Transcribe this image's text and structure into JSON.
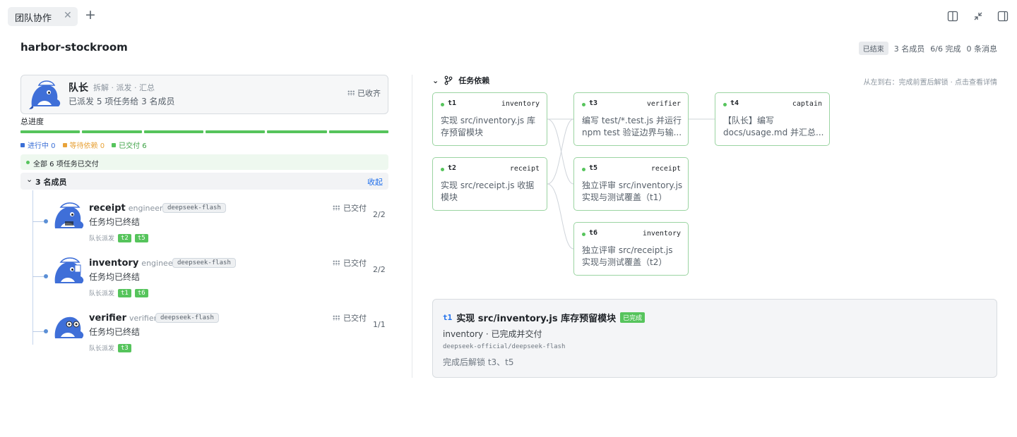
{
  "tab": {
    "label": "团队协作",
    "close": "✕",
    "add": "+"
  },
  "header": {
    "title": "harbor-stockroom",
    "status_badge": "已结束",
    "members": "3 名成员",
    "progress": "6/6 完成",
    "messages": "0 条消息"
  },
  "captain": {
    "name": "队长",
    "role": "拆解 · 派发 · 汇总",
    "description": "已派发 5 项任务给 3 名成员",
    "status": "已收齐"
  },
  "progress": {
    "label": "总进度",
    "segments_total": 6,
    "segments_done": 6,
    "legend": [
      {
        "label": "进行中 0",
        "color": "#3b6fd6"
      },
      {
        "label": "等待依赖 0",
        "color": "#e8a33a"
      },
      {
        "label": "已交付 6",
        "color": "#56c45c"
      }
    ]
  },
  "all_done": "全部 6 项任务已交付",
  "members_section": {
    "title": "3 名成员",
    "caret": "⌄",
    "collapse": "收起",
    "assign_label": "队长派发",
    "items": [
      {
        "name": "receipt",
        "role": "engineer",
        "model": "deepseek-flash",
        "sub": "任务均已终结",
        "status": "已交付",
        "count": "2/2",
        "tasks": [
          "t2",
          "t5"
        ]
      },
      {
        "name": "inventory",
        "role": "engineer",
        "model": "deepseek-flash",
        "sub": "任务均已终结",
        "status": "已交付",
        "count": "2/2",
        "tasks": [
          "t1",
          "t6"
        ]
      },
      {
        "name": "verifier",
        "role": "verifier",
        "model": "deepseek-flash",
        "sub": "任务均已终结",
        "status": "已交付",
        "count": "1/1",
        "tasks": [
          "t3"
        ]
      }
    ]
  },
  "deps": {
    "title": "任务依赖",
    "hint": "从左到右：完成前置后解锁 · 点击查看详情",
    "nodes": [
      {
        "id": "t1",
        "owner": "inventory",
        "desc": "实现 src/inventory.js 库存预留模块"
      },
      {
        "id": "t2",
        "owner": "receipt",
        "desc": "实现 src/receipt.js 收据模块"
      },
      {
        "id": "t3",
        "owner": "verifier",
        "desc": "编写 test/*.test.js 并运行 npm test 验证边界与输..."
      },
      {
        "id": "t5",
        "owner": "receipt",
        "desc": "独立评审 src/inventory.js 实现与测试覆盖（t1）"
      },
      {
        "id": "t6",
        "owner": "inventory",
        "desc": "独立评审 src/receipt.js 实现与测试覆盖（t2）"
      },
      {
        "id": "t4",
        "owner": "captain",
        "desc": "【队长】编写 docs/usage.md 并汇总..."
      }
    ]
  },
  "detail": {
    "id": "t1",
    "title": "实现 src/inventory.js 库存预留模块",
    "badge": "已完成",
    "line1": "inventory · 已完成并交付",
    "model": "deepseek-official/deepseek-flash",
    "unlock": "完成后解锁 t3、t5"
  },
  "colors": {
    "done": "#56c45c",
    "accent": "#1f6feb",
    "avatar": "#3f6fd8"
  }
}
